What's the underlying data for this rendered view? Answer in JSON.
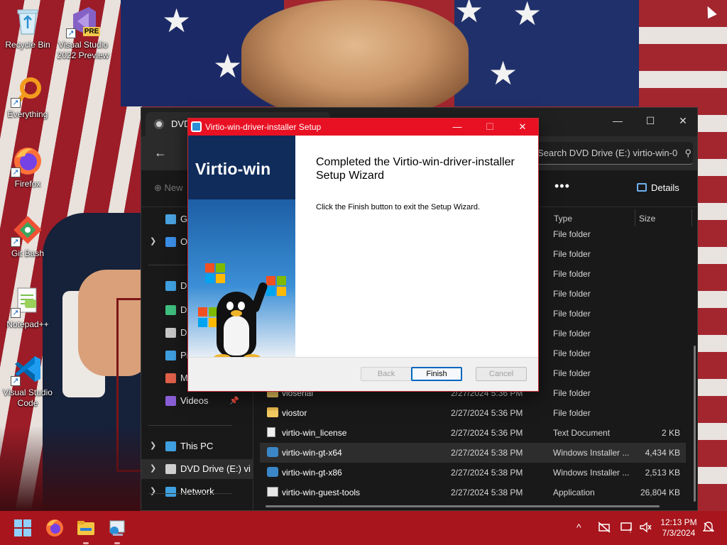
{
  "desktop": {
    "icons": [
      {
        "label": "Recycle Bin",
        "icon": "recycle-bin-icon"
      },
      {
        "label": "Visual Studio 2022 Preview",
        "icon": "visual-studio-icon",
        "badge": "PRE"
      },
      {
        "label": "Everything",
        "icon": "everything-search-icon"
      },
      {
        "label": "Firefox",
        "icon": "firefox-icon"
      },
      {
        "label": "Git Bash",
        "icon": "git-bash-icon"
      },
      {
        "label": "Notepad++",
        "icon": "notepad-plus-plus-icon"
      },
      {
        "label": "Visual Studio Code",
        "icon": "vscode-icon"
      }
    ]
  },
  "explorer": {
    "tab_title": "DVD",
    "search_placeholder": "Search DVD Drive (E:) virtio-win-0",
    "toolbar": {
      "new_label": "New",
      "more_label": "•••",
      "details_label": "Details"
    },
    "nav": [
      {
        "label": "Ga",
        "icon": "gallery-icon",
        "color": "#4aa3df",
        "chevron": false
      },
      {
        "label": "Or",
        "icon": "onedrive-icon",
        "color": "#3a8ee6",
        "chevron": true
      },
      {
        "label": "De",
        "icon": "desktop-icon",
        "color": "#3fa0e0",
        "chevron": false
      },
      {
        "label": "Do",
        "icon": "downloads-icon",
        "color": "#3fbf7f",
        "chevron": false
      },
      {
        "label": "Do",
        "icon": "documents-icon",
        "color": "#c8c8c8",
        "chevron": false
      },
      {
        "label": "Pi",
        "icon": "pictures-icon",
        "color": "#3f9fe0",
        "chevron": false
      },
      {
        "label": "M",
        "icon": "music-icon",
        "color": "#e0604a",
        "chevron": false
      },
      {
        "label": "Videos",
        "icon": "videos-icon",
        "color": "#8a5fd6",
        "chevron": false
      },
      {
        "label": "This PC",
        "icon": "this-pc-icon",
        "color": "#3fa0e0",
        "chevron": true
      },
      {
        "label": "DVD Drive (E:) vi",
        "icon": "dvd-drive-icon",
        "color": "#cfcfcf",
        "chevron": true
      },
      {
        "label": "Network",
        "icon": "network-icon",
        "color": "#3fa0e0",
        "chevron": true
      }
    ],
    "columns": {
      "type": "Type",
      "size": "Size"
    },
    "rows": [
      {
        "name": "",
        "date": "",
        "type": "File folder",
        "size": "",
        "icon": "folder-icon"
      },
      {
        "name": "",
        "date": "",
        "type": "File folder",
        "size": "",
        "icon": "folder-icon"
      },
      {
        "name": "",
        "date": "",
        "type": "File folder",
        "size": "",
        "icon": "folder-icon"
      },
      {
        "name": "",
        "date": "",
        "type": "File folder",
        "size": "",
        "icon": "folder-icon"
      },
      {
        "name": "",
        "date": "",
        "type": "File folder",
        "size": "",
        "icon": "folder-icon"
      },
      {
        "name": "",
        "date": "",
        "type": "File folder",
        "size": "",
        "icon": "folder-icon"
      },
      {
        "name": "",
        "date": "",
        "type": "File folder",
        "size": "",
        "icon": "folder-icon"
      },
      {
        "name": "",
        "date": "",
        "type": "File folder",
        "size": "",
        "icon": "folder-icon"
      },
      {
        "name": "vioserial",
        "date": "2/27/2024 5:36 PM",
        "type": "File folder",
        "size": "",
        "icon": "folder-icon"
      },
      {
        "name": "viostor",
        "date": "2/27/2024 5:36 PM",
        "type": "File folder",
        "size": "",
        "icon": "folder-icon"
      },
      {
        "name": "virtio-win_license",
        "date": "2/27/2024 5:36 PM",
        "type": "Text Document",
        "size": "2 KB",
        "icon": "text-document-icon"
      },
      {
        "name": "virtio-win-gt-x64",
        "date": "2/27/2024 5:38 PM",
        "type": "Windows Installer ...",
        "size": "4,434 KB",
        "icon": "installer-icon",
        "selected": true
      },
      {
        "name": "virtio-win-gt-x86",
        "date": "2/27/2024 5:38 PM",
        "type": "Windows Installer ...",
        "size": "2,513 KB",
        "icon": "installer-icon"
      },
      {
        "name": "virtio-win-guest-tools",
        "date": "2/27/2024 5:38 PM",
        "type": "Application",
        "size": "26,804 KB",
        "icon": "application-icon"
      }
    ]
  },
  "setup": {
    "title": "Virtio-win-driver-installer Setup",
    "banner_title": "Virtio-win",
    "heading": "Completed the Virtio-win-driver-installer Setup Wizard",
    "body": "Click the Finish button to exit the Setup Wizard.",
    "buttons": {
      "back": "Back",
      "finish": "Finish",
      "cancel": "Cancel"
    }
  },
  "taskbar": {
    "apps": [
      "start-icon",
      "firefox-icon",
      "file-explorer-icon",
      "setup-installer-icon"
    ],
    "clock_time": "12:13 PM",
    "clock_date": "7/3/2024",
    "tray_chevron": "^"
  }
}
